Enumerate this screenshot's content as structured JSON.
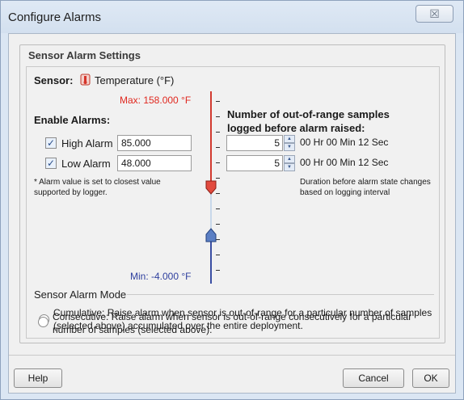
{
  "window": {
    "title": "Configure Alarms",
    "close_glyph": "☒"
  },
  "group": {
    "title": "Sensor Alarm Settings"
  },
  "sensor": {
    "label": "Sensor:",
    "name": "Temperature (°F)",
    "icon": "thermometer-icon"
  },
  "scale": {
    "max_label": "Max: 158.000 °F",
    "min_label": "Min: -4.000 °F",
    "max": 158.0,
    "min": -4.0,
    "high_color": "#e0281f",
    "low_color": "#2e3f9e"
  },
  "alarms": {
    "heading": "Enable Alarms:",
    "high": {
      "label": "High Alarm",
      "checked": true,
      "value": "85.000"
    },
    "low": {
      "label": "Low Alarm",
      "checked": true,
      "value": "48.000"
    },
    "note": "* Alarm value is set to closest value supported by logger."
  },
  "samples": {
    "heading": "Number of out-of-range samples logged before alarm raised:",
    "high": {
      "count": "5",
      "duration": "00 Hr 00 Min 12 Sec"
    },
    "low": {
      "count": "5",
      "duration": "00 Hr 00 Min 12 Sec"
    },
    "note": "Duration before alarm state changes based on logging interval"
  },
  "mode": {
    "heading": "Sensor Alarm Mode",
    "cumulative": {
      "text": "Cumulative: Raise alarm when sensor is out-of-range for a particular number of samples (selected above) accumulated over the entire deployment.",
      "selected": true
    },
    "consecutive": {
      "text": "Consecutive: Raise alarm when sensor is out-of-range consecutively for a particular number of samples (selected above).",
      "selected": false
    }
  },
  "footer": {
    "help": "Help",
    "cancel": "Cancel",
    "ok": "OK"
  }
}
